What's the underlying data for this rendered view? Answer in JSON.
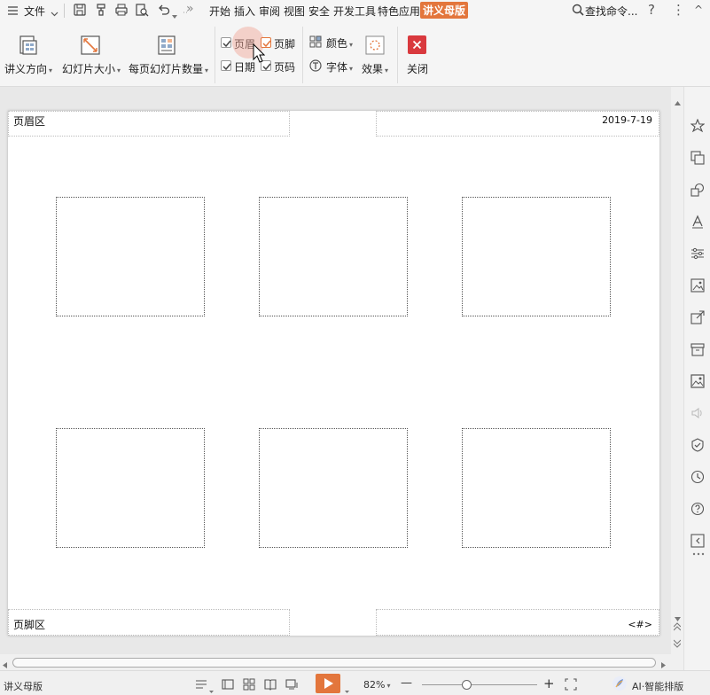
{
  "menubar": {
    "file_label": "文件",
    "more_glyph": "»",
    "tabs": [
      {
        "label": "开始"
      },
      {
        "label": "插入"
      },
      {
        "label": "审阅"
      },
      {
        "label": "视图"
      },
      {
        "label": "安全"
      },
      {
        "label": "开发工具"
      },
      {
        "label": "特色应用"
      },
      {
        "label": "讲义母版",
        "active": true
      }
    ],
    "search_label": "查找命令...",
    "help_glyph": "?",
    "more_glyph2": "⋮",
    "collapse_glyph": "^"
  },
  "ribbon": {
    "orientation_label": "讲义方向",
    "slide_size_label": "幻灯片大小",
    "per_page_label": "每页幻灯片数量",
    "header": {
      "label": "页眉",
      "checked": true
    },
    "footer": {
      "label": "页脚",
      "checked": true
    },
    "date": {
      "label": "日期",
      "checked": true
    },
    "page_number": {
      "label": "页码",
      "checked": true
    },
    "color_label": "颜色",
    "font_label": "字体",
    "effect_label": "效果",
    "close_label": "关闭"
  },
  "page": {
    "header_text": "页眉区",
    "date_text": "2019-7-19",
    "footer_text": "页脚区",
    "page_number_text": "<#>"
  },
  "statusbar": {
    "mode_label": "讲义母版",
    "zoom_label": "82%",
    "zoom_minus": "—",
    "zoom_plus": "+",
    "ai_label": "AI·智能排版"
  },
  "colors": {
    "accent": "#e3763c",
    "close": "#d9393e",
    "check": "#e3763c"
  }
}
